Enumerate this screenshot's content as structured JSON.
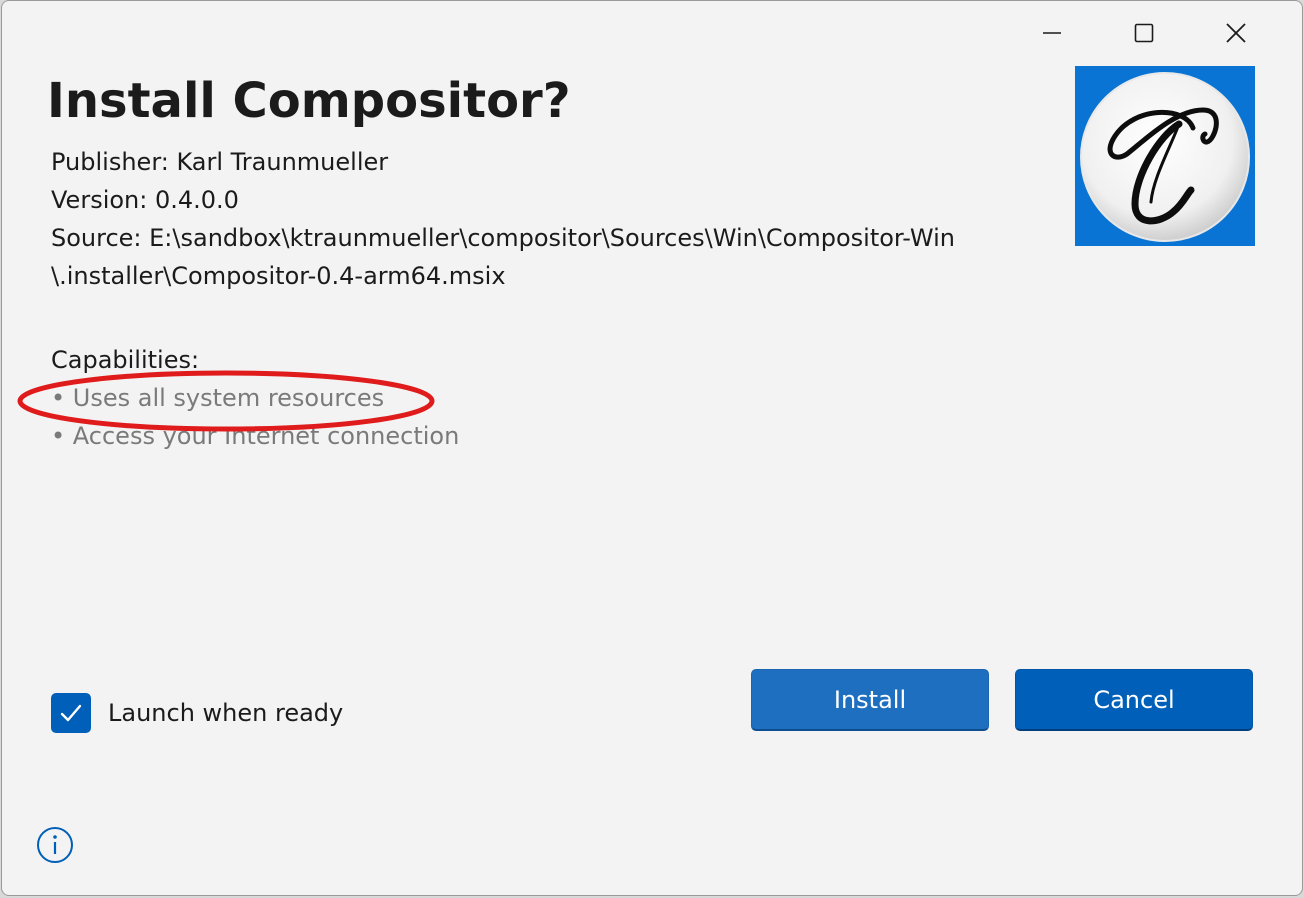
{
  "window": {
    "controls": {
      "minimize_icon": "minimize-icon",
      "maximize_icon": "maximize-icon",
      "close_icon": "close-icon"
    }
  },
  "header": {
    "title": "Install Compositor?"
  },
  "details": {
    "publisher": "Publisher: Karl Traunmueller",
    "version": "Version: 0.4.0.0",
    "source_line1": "Source: E:\\sandbox\\ktraunmueller\\compositor\\Sources\\Win\\Compositor-Win",
    "source_line2": "\\.installer\\Compositor-0.4-arm64.msix"
  },
  "app_icon": {
    "name": "compositor-logo",
    "background": "#0a74d4"
  },
  "capabilities": {
    "title": "Capabilities:",
    "items": [
      "• Uses all system resources",
      "• Access your Internet connection"
    ]
  },
  "launch": {
    "label": "Launch when ready",
    "checked": true
  },
  "buttons": {
    "install": "Install",
    "cancel": "Cancel"
  },
  "colors": {
    "accent": "#005fb8",
    "annotation": "#e01b1b",
    "window_bg": "#f3f3f3"
  }
}
